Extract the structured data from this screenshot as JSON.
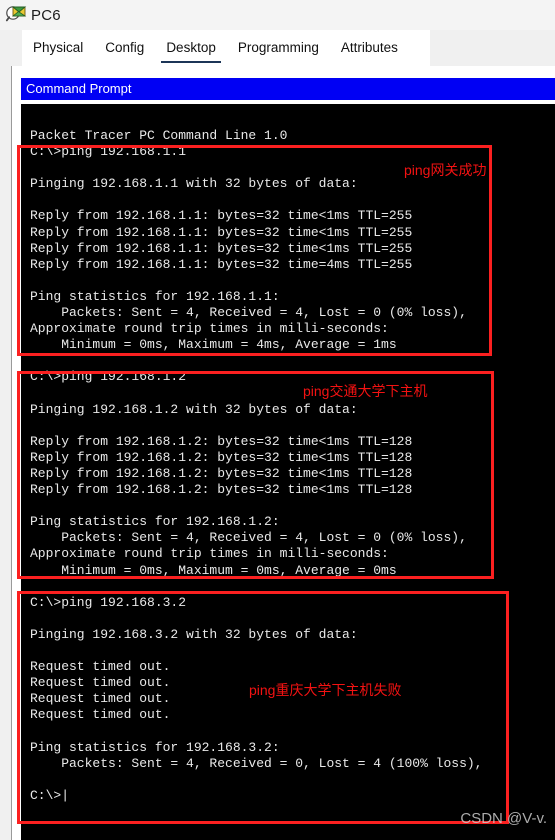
{
  "window": {
    "title": "PC6",
    "icon": "pc-device-icon"
  },
  "tabs": [
    {
      "label": "Physical",
      "active": false
    },
    {
      "label": "Config",
      "active": false
    },
    {
      "label": "Desktop",
      "active": true
    },
    {
      "label": "Programming",
      "active": false
    },
    {
      "label": "Attributes",
      "active": false
    }
  ],
  "command_prompt": {
    "title": "Command Prompt",
    "titlebar_color": "#0000f4",
    "background_color": "#000000",
    "text_color": "#e9e9e9",
    "terminal_text": "Packet Tracer PC Command Line 1.0\nC:\\>ping 192.168.1.1\n\nPinging 192.168.1.1 with 32 bytes of data:\n\nReply from 192.168.1.1: bytes=32 time<1ms TTL=255\nReply from 192.168.1.1: bytes=32 time<1ms TTL=255\nReply from 192.168.1.1: bytes=32 time<1ms TTL=255\nReply from 192.168.1.1: bytes=32 time=4ms TTL=255\n\nPing statistics for 192.168.1.1:\n    Packets: Sent = 4, Received = 4, Lost = 0 (0% loss),\nApproximate round trip times in milli-seconds:\n    Minimum = 0ms, Maximum = 4ms, Average = 1ms\n\nC:\\>ping 192.168.1.2\n\nPinging 192.168.1.2 with 32 bytes of data:\n\nReply from 192.168.1.2: bytes=32 time<1ms TTL=128\nReply from 192.168.1.2: bytes=32 time<1ms TTL=128\nReply from 192.168.1.2: bytes=32 time<1ms TTL=128\nReply from 192.168.1.2: bytes=32 time<1ms TTL=128\n\nPing statistics for 192.168.1.2:\n    Packets: Sent = 4, Received = 4, Lost = 0 (0% loss),\nApproximate round trip times in milli-seconds:\n    Minimum = 0ms, Maximum = 0ms, Average = 0ms\n\nC:\\>ping 192.168.3.2\n\nPinging 192.168.3.2 with 32 bytes of data:\n\nRequest timed out.\nRequest timed out.\nRequest timed out.\nRequest timed out.\n\nPing statistics for 192.168.3.2:\n    Packets: Sent = 4, Received = 0, Lost = 4 (100% loss),\n\nC:\\>|"
  },
  "annotations": {
    "color": "#f31212",
    "items": [
      {
        "label": "ping网关成功"
      },
      {
        "label": "ping交通大学下主机"
      },
      {
        "label": "ping重庆大学下主机失败"
      }
    ]
  },
  "watermark": {
    "text": "CSDN @V-v."
  }
}
